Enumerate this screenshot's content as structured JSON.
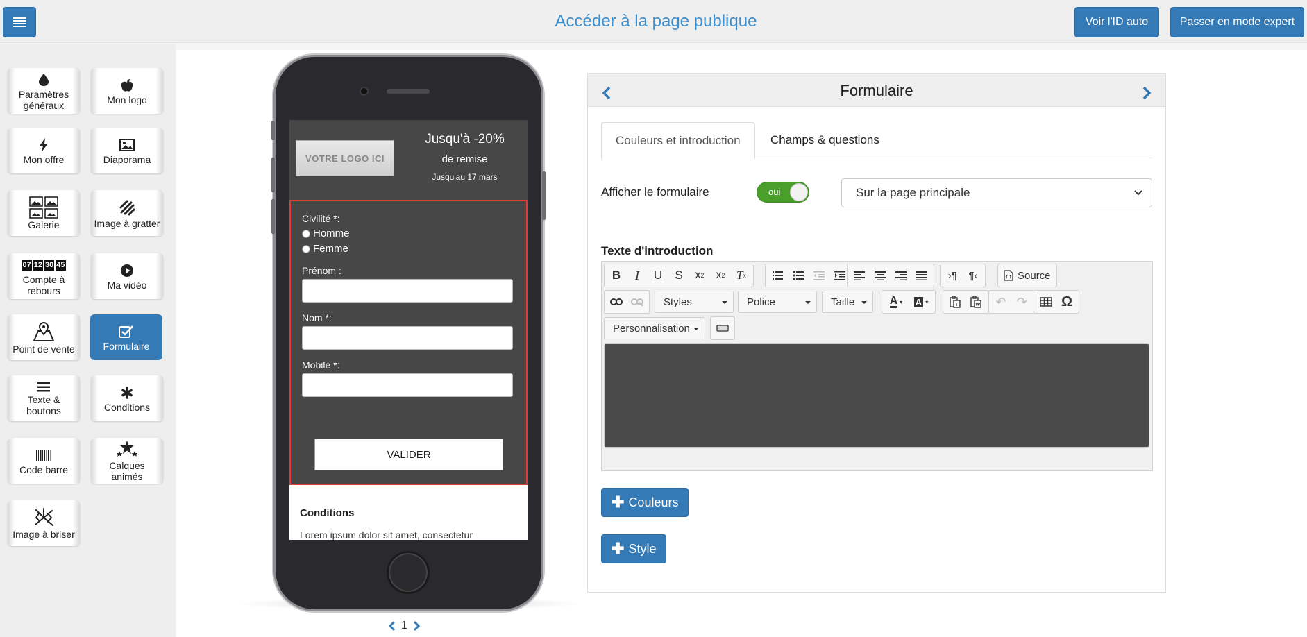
{
  "header": {
    "public_link": "Accéder à la page publique",
    "btn_auto_id": "Voir l'ID auto",
    "btn_expert": "Passer en mode expert",
    "accent": "#337ab7"
  },
  "sidebar": {
    "items": [
      {
        "label": "Paramètres généraux",
        "icon": "drop-icon"
      },
      {
        "label": "Mon logo",
        "icon": "apple-icon"
      },
      {
        "label": "Mon offre",
        "icon": "bolt-icon"
      },
      {
        "label": "Diaporama",
        "icon": "picture-icon"
      },
      {
        "label": "Galerie",
        "icon": "gallery-icon"
      },
      {
        "label": "Image à gratter",
        "icon": "scratch-icon"
      },
      {
        "label": "Compte à rebours",
        "icon": "countdown-icon"
      },
      {
        "label": "Ma vidéo",
        "icon": "play-icon"
      },
      {
        "label": "Point de vente",
        "icon": "map-pin-icon"
      },
      {
        "label": "Formulaire",
        "icon": "checkbox-icon",
        "active": true
      },
      {
        "label": "Texte & boutons",
        "icon": "lines-icon"
      },
      {
        "label": "Conditions",
        "icon": "asterisk-icon"
      },
      {
        "label": "Code barre",
        "icon": "barcode-icon"
      },
      {
        "label": "Calques animés",
        "icon": "stars-icon"
      },
      {
        "label": "Image à briser",
        "icon": "broken-image-icon"
      }
    ],
    "countdown_digits": [
      "07",
      "12",
      "30",
      "45"
    ]
  },
  "preview": {
    "logo_text": "VOTRE LOGO ICI",
    "promo_title": "Jusqu'à -20%",
    "promo_sub": "de remise",
    "promo_date": "Jusqu'au 17 mars",
    "form": {
      "civility_label": "Civilité *:",
      "options": [
        "Homme",
        "Femme"
      ],
      "firstname_label": "Prénom :",
      "lastname_label": "Nom *:",
      "mobile_label": "Mobile *:",
      "submit_label": "VALIDER"
    },
    "conditions_title": "Conditions",
    "conditions_text": "Lorem ipsum dolor sit amet, consectetur",
    "page_number": "1"
  },
  "panel": {
    "title": "Formulaire",
    "tabs": [
      "Couleurs et introduction",
      "Champs & questions"
    ],
    "show_form_label": "Afficher le formulaire",
    "toggle_text": "oui",
    "select_value": "Sur la page principale",
    "intro_label": "Texte d'introduction",
    "editor": {
      "styles": "Styles",
      "font": "Police",
      "size": "Taille",
      "source": "Source",
      "personalisation": "Personnalisation",
      "omega": "Ω"
    },
    "btn_colors": "Couleurs",
    "btn_style": "Style"
  }
}
